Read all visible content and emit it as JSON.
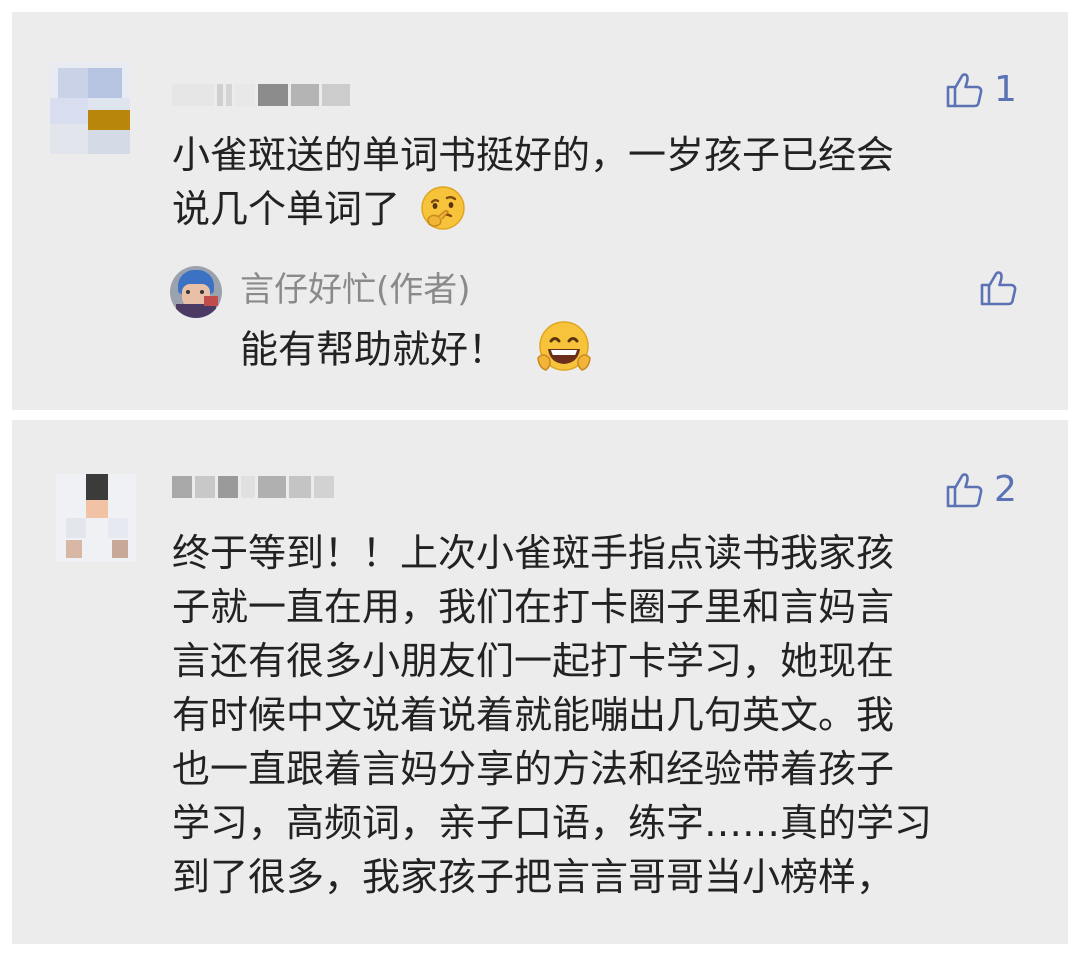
{
  "comments": [
    {
      "likes": "1",
      "text_lines": [
        "小雀斑送的单词书挺好的，一岁孩子已经会",
        "说几个单词了"
      ],
      "emoji": "thinking-face-icon",
      "reply": {
        "author": "言仔好忙(作者)",
        "text": "能有帮助就好！",
        "emoji": "grinning-face-icon"
      }
    },
    {
      "likes": "2",
      "text_lines": [
        "终于等到！！上次小雀斑手指点读书我家孩",
        "子就一直在用，我们在打卡圈子里和言妈言",
        "言还有很多小朋友们一起打卡学习，她现在",
        "有时候中文说着说着就能嘣出几句英文。我",
        "也一直跟着言妈分享的方法和经验带着孩子",
        "学习，高频词，亲子口语，练字……真的学习",
        "到了很多，我家孩子把言言哥哥当小榜样，"
      ]
    }
  ],
  "colors": {
    "card_bg": "#ececec",
    "like_blue": "#5b73b4",
    "text": "#222222",
    "author_gray": "#8a8a8a"
  }
}
